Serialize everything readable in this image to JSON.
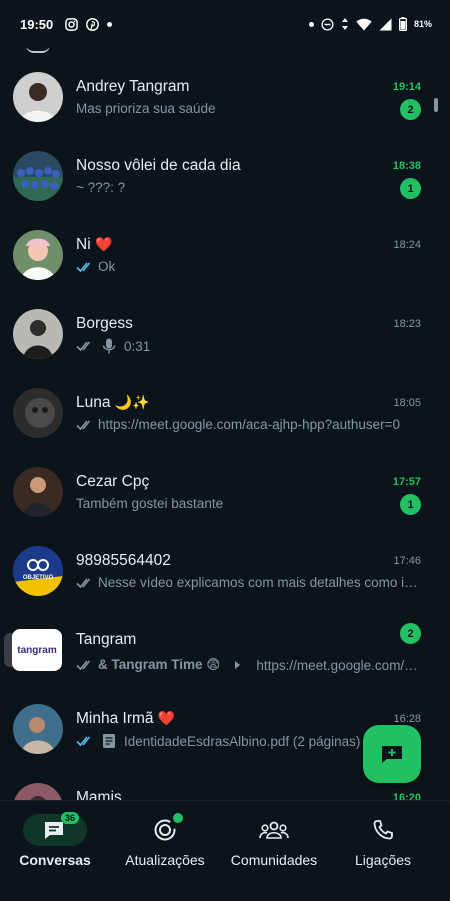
{
  "status_bar": {
    "time": "19:50",
    "battery": "81%"
  },
  "chats": [
    {
      "name": "Andrey Tangram",
      "time": "19:14",
      "preview": "Mas prioriza sua saúde",
      "unread": "2",
      "time_unread": true
    },
    {
      "name": "Nosso vôlei de cada dia",
      "time": "18:38",
      "preview": "~ ???: ?",
      "unread": "1",
      "time_unread": true
    },
    {
      "name": "Ni",
      "name_emoji": "❤️",
      "time": "18:24",
      "preview": "Ok",
      "ticks": "read"
    },
    {
      "name": "Borgess",
      "time": "18:23",
      "preview": "0:31",
      "ticks": "delivered",
      "voice": true
    },
    {
      "name": "Luna",
      "name_emoji": "🌙✨",
      "time": "18:05",
      "preview": "https://meet.google.com/aca-ajhp-hpp?authuser=0",
      "ticks": "delivered"
    },
    {
      "name": "Cezar Cpç",
      "time": "17:57",
      "preview": "Também gostei bastante",
      "unread": "1",
      "time_unread": true
    },
    {
      "name": "98985564402",
      "time": "17:46",
      "preview": "Nesse vídeo explicamos com mais detalhes como i…",
      "ticks": "delivered",
      "avatar_text": "OBJETIVO"
    },
    {
      "name": "Tangram",
      "time": "",
      "preview_prefix": "& Tangram Time 😨",
      "preview": "https://meet.google.com/…",
      "ticks": "delivered",
      "unread": "2",
      "avatar_text": "tangram"
    },
    {
      "name": "Minha Irmã",
      "name_emoji": "❤️",
      "time": "16:28",
      "preview": "IdentidadeEsdrasAlbino.pdf (2 páginas)",
      "ticks": "read",
      "doc": true
    },
    {
      "name": "Mamis",
      "time": "16:20",
      "time_unread": true
    }
  ],
  "nav": [
    {
      "label": "Conversas",
      "count": "36",
      "active": true,
      "icon": "chat-icon"
    },
    {
      "label": "Atualizações",
      "icon": "status-icon",
      "dot": true
    },
    {
      "label": "Comunidades",
      "icon": "communities-icon"
    },
    {
      "label": "Ligações",
      "icon": "phone-icon"
    }
  ],
  "colors": {
    "background": "#0b141a",
    "accent": "#21c063",
    "muted": "#8696a0",
    "read_ticks": "#53bdeb"
  }
}
